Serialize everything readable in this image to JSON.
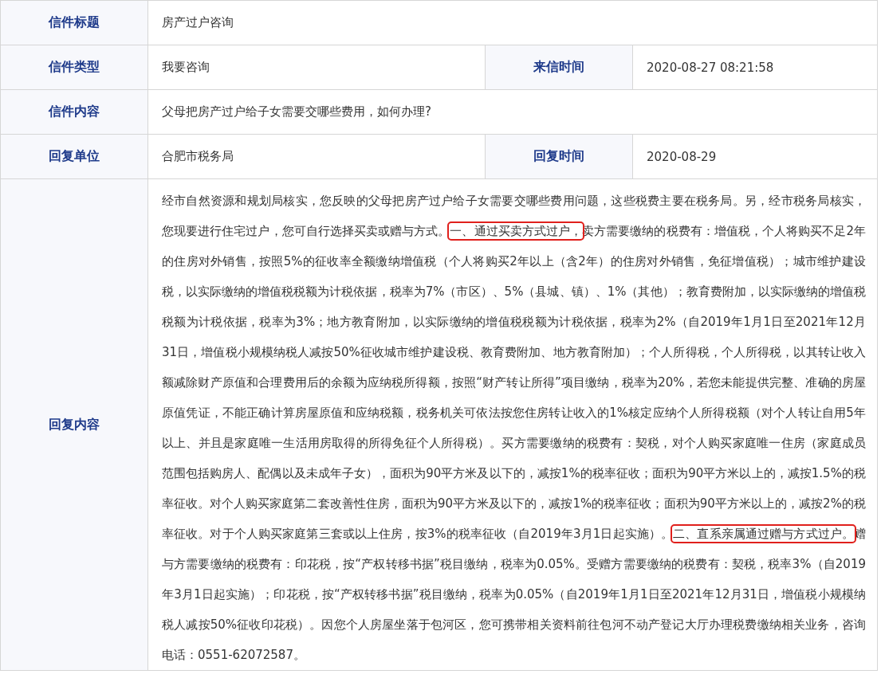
{
  "rows": [
    {
      "label": "信件标题",
      "value": "房产过户咨询"
    },
    {
      "label": "信件类型",
      "value": "我要咨询",
      "label_2": "来信时间",
      "value_2": "2020-08-27 08:21:58"
    },
    {
      "label": "信件内容",
      "value": "父母把房产过户给子女需要交哪些费用，如何办理?"
    },
    {
      "label": "回复单位",
      "value": "合肥市税务局",
      "label_2": "回复时间",
      "value_2": "2020-08-29"
    }
  ],
  "reply": {
    "label": "回复内容",
    "segments": [
      {
        "text": "经市自然资源和规划局核实，您反映的父母把房产过户给子女需要交哪些费用问题，这些税费主要在税务局。另，经市税务局核实，您现要进行住宅过户，您可自行选择买卖或赠与方式。",
        "highlighted": false
      },
      {
        "text": "一、通过买卖方式过户，",
        "highlighted": true
      },
      {
        "text": "卖方需要缴纳的税费有：增值税，个人将购买不足2年的住房对外销售，按照5%的征收率全额缴纳增值税（个人将购买2年以上（含2年）的住房对外销售，免征增值税）；城市维护建设税，以实际缴纳的增值税税额为计税依据，税率为7%（市区）、5%（县城、镇）、1%（其他）；教育费附加，以实际缴纳的增值税税额为计税依据，税率为3%；地方教育附加，以实际缴纳的增值税税额为计税依据，税率为2%（自2019年1月1日至2021年12月31日，增值税小规模纳税人减按50%征收城市维护建设税、教育费附加、地方教育附加）；个人所得税，个人所得税，以其转让收入额减除财产原值和合理费用后的余额为应纳税所得额，按照“财产转让所得”项目缴纳，税率为20%，若您未能提供完整、准确的房屋原值凭证，不能正确计算房屋原值和应纳税额，税务机关可依法按您住房转让收入的1%核定应纳个人所得税额（对个人转让自用5年以上、并且是家庭唯一生活用房取得的所得免征个人所得税）。买方需要缴纳的税费有：契税，对个人购买家庭唯一住房（家庭成员范围包括购房人、配偶以及未成年子女），面积为90平方米及以下的，减按1%的税率征收；面积为90平方米以上的，减按1.5%的税率征收。对个人购买家庭第二套改善性住房，面积为90平方米及以下的，减按1%的税率征收；面积为90平方米以上的，减按2%的税率征收。对于个人购买家庭第三套或以上住房，按3%的税率征收（自2019年3月1日起实施）。",
        "highlighted": false
      },
      {
        "text": "二、直系亲属通过赠与方式过户。",
        "highlighted": true
      },
      {
        "text": "赠与方需要缴纳的税费有：印花税，按“产权转移书据”税目缴纳，税率为0.05%。受赠方需要缴纳的税费有：契税，税率3%（自2019年3月1日起实施）；印花税，按“产权转移书据”税目缴纳，税率为0.05%（自2019年1月1日至2021年12月31日，增值税小规模纳税人减按50%征收印花税）。因您个人房屋坐落于包河区，您可携带相关资料前往包河不动产登记大厅办理税费缴纳相关业务，咨询电话：0551-62072587。",
        "highlighted": false
      }
    ]
  }
}
